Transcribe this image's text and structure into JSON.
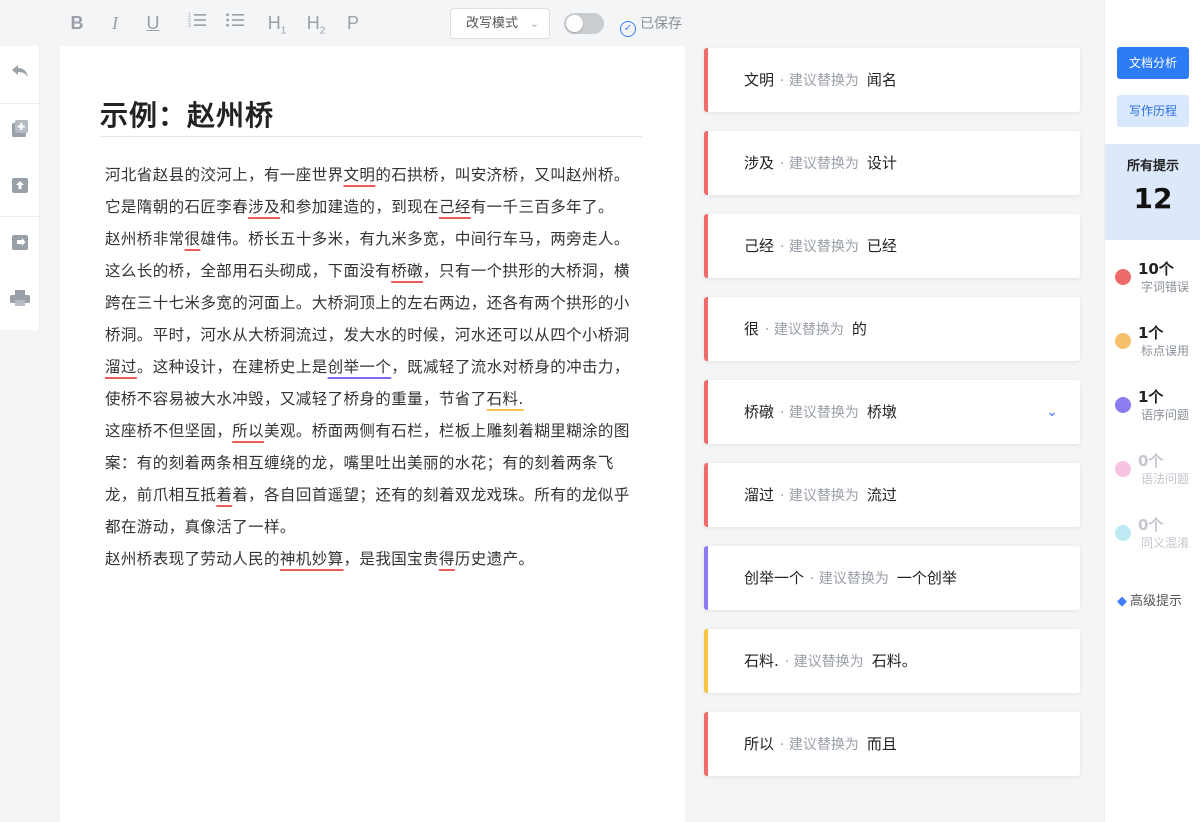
{
  "toolbar": {
    "format_buttons": [
      "B",
      "I",
      "U",
      "",
      "",
      "H",
      "H",
      "P"
    ],
    "mode_select": "改写模式",
    "saved_label": "已保存"
  },
  "document": {
    "title": "示例：赵州桥",
    "paragraphs": [
      [
        {
          "t": "河北省赵县的洨河上，有一座世界"
        },
        {
          "t": "文明",
          "c": "red"
        },
        {
          "t": "的石拱桥，叫安济桥，又叫赵州桥。它是隋朝的石匠李春"
        },
        {
          "t": "涉及",
          "c": "red"
        },
        {
          "t": "和参加建造的，到现在"
        },
        {
          "t": "己经",
          "c": "red"
        },
        {
          "t": "有一千三百多年了。"
        }
      ],
      [
        {
          "t": "赵州桥非常"
        },
        {
          "t": "很",
          "c": "red"
        },
        {
          "t": "雄伟。桥长五十多米，有九米多宽，中间行车马，两旁走人。这么长的桥，全部用石头砌成，下面没有"
        },
        {
          "t": "桥礅",
          "c": "red"
        },
        {
          "t": "，只有一个拱形的大桥洞，横跨在三十七米多宽的河面上。大桥洞顶上的左右两边，还各有两个拱形的小桥洞。平时，河水从大桥洞流过，发大水的时候，河水还可以从四个小桥洞"
        },
        {
          "t": "溜过",
          "c": "red"
        },
        {
          "t": "。这种设计，在建桥史上是"
        },
        {
          "t": "创举一个",
          "c": "purple"
        },
        {
          "t": "，既减轻了流水对桥身的冲击力，使桥不容易被大水冲毁，又减轻了桥身的重量，节省了"
        },
        {
          "t": "石料.",
          "c": "yellow"
        }
      ],
      [
        {
          "t": "这座桥不但坚固，"
        },
        {
          "t": "所以",
          "c": "red"
        },
        {
          "t": "美观。桥面两侧有石栏，栏板上雕刻着糊里糊涂的图案：有的刻着两条相互缠绕的龙，嘴里吐出美丽的水花；有的刻着两条飞龙，前爪相互抵"
        },
        {
          "t": "着",
          "c": "red"
        },
        {
          "t": "着，各自回首遥望；还有的刻着双龙戏珠。所有的龙似乎都在游动，真像活了一样。"
        }
      ],
      [
        {
          "t": "赵州桥表现了劳动人民的"
        },
        {
          "t": "神机妙算",
          "c": "red"
        },
        {
          "t": "，是我国宝贵"
        },
        {
          "t": "得",
          "c": "red"
        },
        {
          "t": "历史遗产。"
        }
      ]
    ]
  },
  "suggestions": [
    {
      "original": "文明",
      "hint": "· 建议替换为",
      "replacement": "闻名",
      "color": "red"
    },
    {
      "original": "涉及",
      "hint": "· 建议替换为",
      "replacement": "设计",
      "color": "red"
    },
    {
      "original": "己经",
      "hint": "· 建议替换为",
      "replacement": "已经",
      "color": "red"
    },
    {
      "original": "很",
      "hint": "· 建议替换为",
      "replacement": "的",
      "color": "red"
    },
    {
      "original": "桥礅",
      "hint": "· 建议替换为",
      "replacement": "桥墩",
      "color": "red",
      "expand": "⌄"
    },
    {
      "original": "溜过",
      "hint": "· 建议替换为",
      "replacement": "流过",
      "color": "red"
    },
    {
      "original": "创举一个",
      "hint": "· 建议替换为",
      "replacement": "一个创举",
      "color": "purple"
    },
    {
      "original": "石料.",
      "hint": "· 建议替换为",
      "replacement": "石料。",
      "color": "yellow"
    },
    {
      "original": "所以",
      "hint": "· 建议替换为",
      "replacement": "而且",
      "color": "red"
    }
  ],
  "panel": {
    "analyze_button": "文档分析",
    "history_button": "写作历程",
    "all_label": "所有提示",
    "all_count": "12",
    "stats": [
      {
        "count": "10个",
        "label": "字词错误",
        "color": "#ef6b6b"
      },
      {
        "count": "1个",
        "label": "标点误用",
        "color": "#f6c16a"
      },
      {
        "count": "1个",
        "label": "语序问题",
        "color": "#8b7cf3"
      },
      {
        "count": "0个",
        "label": "语法问题",
        "color": "#f6c3e0"
      },
      {
        "count": "0个",
        "label": "同义混淆",
        "color": "#bde9f5"
      }
    ],
    "advanced_label": "高级提示"
  },
  "colors": {
    "accent": "#2d7cf6",
    "error_red": "#ef6b6b",
    "order_purple": "#8b7cf3",
    "punct_yellow": "#f6c445"
  }
}
